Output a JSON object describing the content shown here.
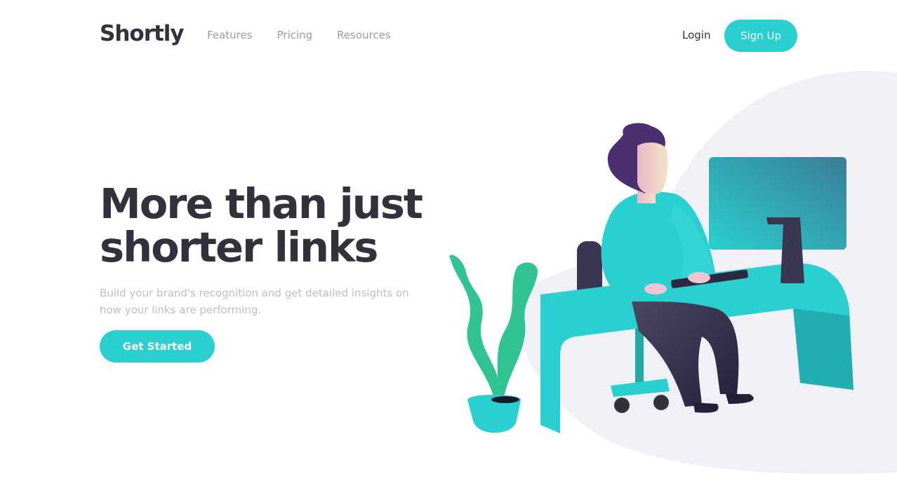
{
  "nav": {
    "logo": "Shortly",
    "links": [
      {
        "label": "Features"
      },
      {
        "label": "Pricing"
      },
      {
        "label": "Resources"
      }
    ],
    "login": "Login",
    "signup": "Sign Up"
  },
  "hero": {
    "title": "More than just shorter links",
    "subtitle": "Build your brand's recognition and get detailed insights on how your links are performing.",
    "cta": "Get Started",
    "illustration": "person-working-at-desk-illustration"
  },
  "colors": {
    "primary": "#2acfcf",
    "dark": "#34313d",
    "gray": "#9e9aa8",
    "light_bg": "#f0f1f6",
    "plant": "#30c495"
  }
}
